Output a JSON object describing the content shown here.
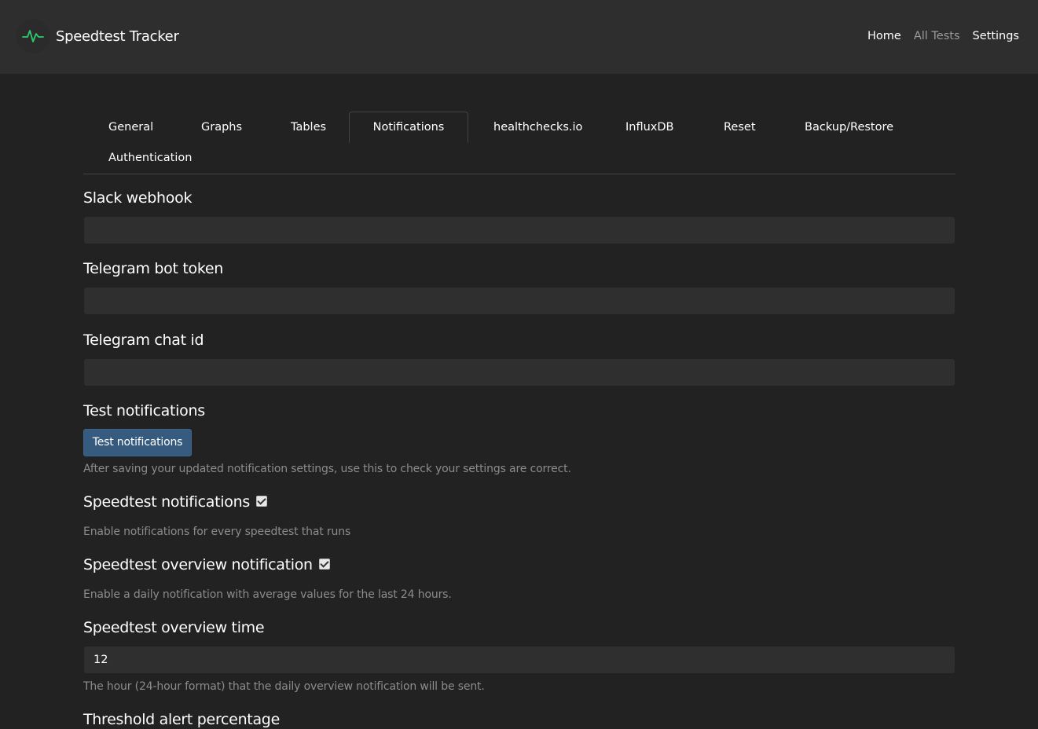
{
  "app": {
    "title": "Speedtest Tracker",
    "accent_color": "#2ecc71"
  },
  "nav": {
    "links": [
      "Home",
      "All Tests",
      "Settings"
    ]
  },
  "tabs": [
    "General",
    "Graphs",
    "Tables",
    "Notifications",
    "healthchecks.io",
    "InfluxDB",
    "Reset",
    "Backup/Restore",
    "Authentication"
  ],
  "active_tab": "Notifications",
  "form": {
    "slack_webhook": {
      "label": "Slack webhook",
      "value": ""
    },
    "telegram_bot_token": {
      "label": "Telegram bot token",
      "value": ""
    },
    "telegram_chat_id": {
      "label": "Telegram chat id",
      "value": ""
    },
    "test_notifications": {
      "label": "Test notifications",
      "button": "Test notifications",
      "help": "After saving your updated notification settings, use this to check your settings are correct."
    },
    "speedtest_notifications": {
      "label": "Speedtest notifications",
      "checked": true,
      "help": "Enable notifications for every speedtest that runs"
    },
    "speedtest_overview_notification": {
      "label": "Speedtest overview notification",
      "checked": true,
      "help": "Enable a daily notification with average values for the last 24 hours."
    },
    "speedtest_overview_time": {
      "label": "Speedtest overview time",
      "value": "12",
      "help": "The hour (24-hour format) that the daily overview notification will be sent."
    },
    "threshold_alert_percentage": {
      "label": "Threshold alert percentage"
    }
  }
}
